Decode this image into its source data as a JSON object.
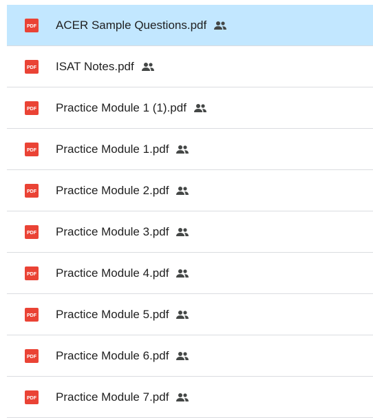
{
  "files": [
    {
      "name": "ACER Sample Questions.pdf",
      "type_icon": "pdf-icon",
      "shared": true,
      "selected": true
    },
    {
      "name": "ISAT Notes.pdf",
      "type_icon": "pdf-icon",
      "shared": true,
      "selected": false
    },
    {
      "name": "Practice Module 1 (1).pdf",
      "type_icon": "pdf-icon",
      "shared": true,
      "selected": false
    },
    {
      "name": "Practice Module 1.pdf",
      "type_icon": "pdf-icon",
      "shared": true,
      "selected": false
    },
    {
      "name": "Practice Module 2.pdf",
      "type_icon": "pdf-icon",
      "shared": true,
      "selected": false
    },
    {
      "name": "Practice Module 3.pdf",
      "type_icon": "pdf-icon",
      "shared": true,
      "selected": false
    },
    {
      "name": "Practice Module 4.pdf",
      "type_icon": "pdf-icon",
      "shared": true,
      "selected": false
    },
    {
      "name": "Practice Module 5.pdf",
      "type_icon": "pdf-icon",
      "shared": true,
      "selected": false
    },
    {
      "name": "Practice Module 6.pdf",
      "type_icon": "pdf-icon",
      "shared": true,
      "selected": false
    },
    {
      "name": "Practice Module 7.pdf",
      "type_icon": "pdf-icon",
      "shared": true,
      "selected": false
    }
  ],
  "icon_label": "PDF",
  "colors": {
    "selected_bg": "#c2e7ff",
    "pdf_red": "#ea4335",
    "text": "#1f1f1f",
    "shared_icon": "#444746",
    "divider": "#dadce0"
  }
}
